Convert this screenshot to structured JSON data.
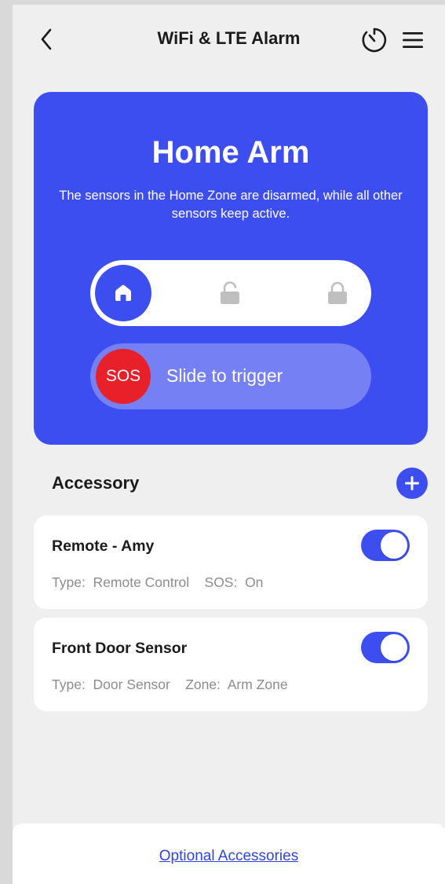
{
  "header": {
    "title": "WiFi & LTE Alarm",
    "back_icon": "chevron-left-icon",
    "timer_icon": "timer-icon",
    "menu_icon": "hamburger-menu-icon"
  },
  "mode_card": {
    "title": "Home Arm",
    "description": "The sensors in the Home Zone are disarmed, while all other sensors keep active.",
    "modes": [
      {
        "icon": "home-icon",
        "selected": true
      },
      {
        "icon": "unlocked-icon",
        "selected": false
      },
      {
        "icon": "locked-icon",
        "selected": false
      }
    ],
    "sos_label": "SOS",
    "sos_hint": "Slide to trigger"
  },
  "accessory": {
    "title": "Accessory",
    "add_icon": "plus-icon",
    "items": [
      {
        "name": "Remote - Amy",
        "meta": "Type:  Remote Control    SOS:  On",
        "enabled": true
      },
      {
        "name": "Front Door Sensor",
        "meta": "Type:  Door Sensor    Zone:  Arm Zone",
        "enabled": true
      }
    ]
  },
  "footer": {
    "link_label": "Optional Accessories"
  },
  "colors": {
    "accent": "#3d4ef0",
    "sos_red": "#e8202a",
    "background": "#efefef"
  }
}
